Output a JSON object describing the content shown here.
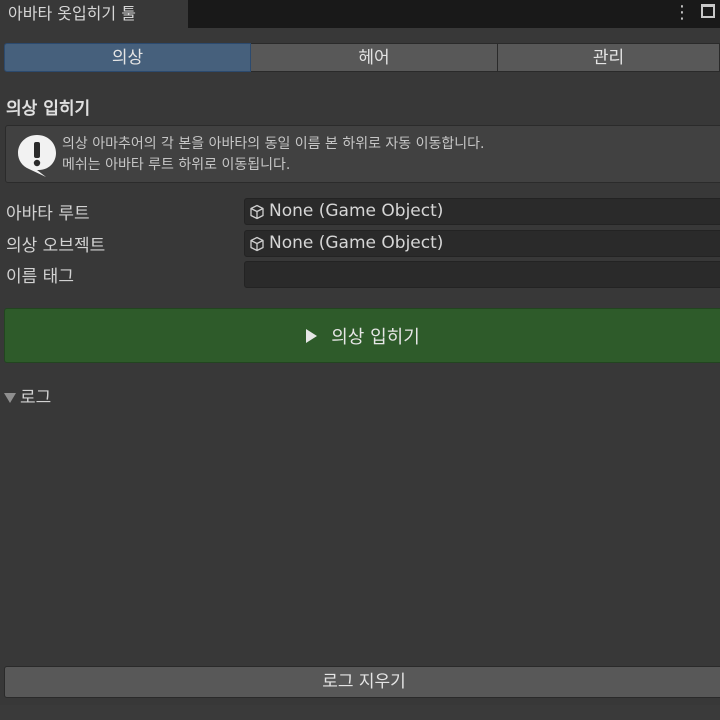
{
  "window": {
    "title": "아바타 옷입히기 툴"
  },
  "tabs": [
    {
      "label": "의상",
      "active": true
    },
    {
      "label": "헤어",
      "active": false
    },
    {
      "label": "관리",
      "active": false
    }
  ],
  "section": {
    "title": "의상 입히기",
    "help": {
      "line1": "의상 아마추어의 각 본을 아바타의 동일 이름 본 하위로 자동 이동합니다.",
      "line2": "메쉬는 아바타 루트 하위로 이동됩니다."
    }
  },
  "fields": {
    "avatar_root": {
      "label": "아바타 루트",
      "value": "None (Game Object)"
    },
    "outfit_object": {
      "label": "의상 오브젝트",
      "value": "None (Game Object)"
    },
    "name_tag": {
      "label": "이름 태그",
      "value": ""
    }
  },
  "actions": {
    "apply_label": "의상 입히기",
    "clear_log_label": "로그 지우기"
  },
  "log": {
    "title": "로그"
  },
  "colors": {
    "accent_tab": "#46607c",
    "apply_button": "#2e5b2a",
    "background": "#383838"
  },
  "icons": {
    "help": "exclamation-speech-icon",
    "object": "cube-icon",
    "menu": "kebab-menu-icon",
    "maximize": "maximize-icon"
  }
}
